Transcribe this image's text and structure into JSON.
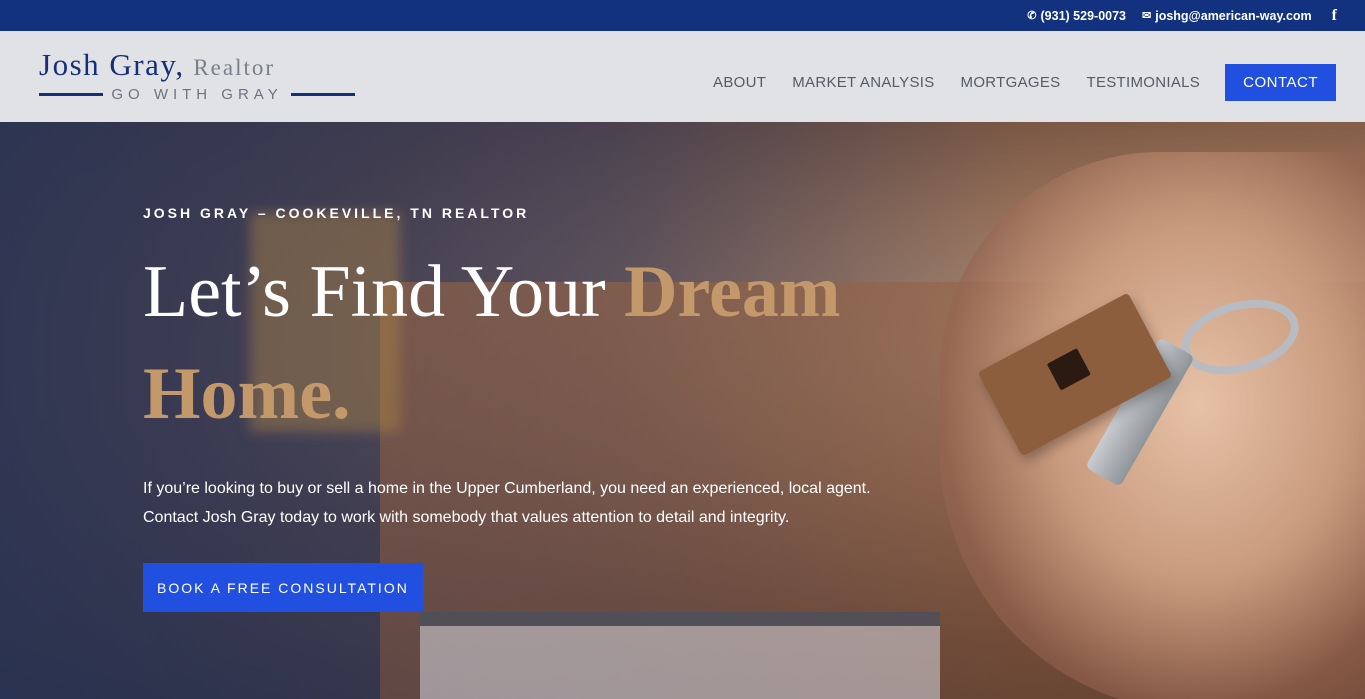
{
  "topbar": {
    "phone": "(931) 529-0073",
    "email": "joshg@american-way.com",
    "phone_icon": "phone-icon",
    "email_icon": "envelope-icon",
    "social_icon": "facebook-icon",
    "social_glyph": "f",
    "background": "#12317f"
  },
  "header": {
    "logo": {
      "name_first": "Josh Gray,",
      "name_second": "Realtor",
      "tagline": "GO WITH GRAY"
    },
    "nav": [
      {
        "label": "ABOUT"
      },
      {
        "label": "MARKET ANALYSIS"
      },
      {
        "label": "MORTGAGES"
      },
      {
        "label": "TESTIMONIALS"
      }
    ],
    "contact_label": "CONTACT"
  },
  "hero": {
    "kicker": "JOSH GRAY – COOKEVILLE, TN REALTOR",
    "headline_plain": "Let’s Find Your ",
    "headline_accent": "Dream Home.",
    "description": "If you’re looking to buy or sell a home in the Upper Cumberland, you need an experienced, local agent.  Contact Josh Gray today to work with somebody that values attention to detail and integrity.",
    "cta_label": "BOOK A FREE CONSULTATION"
  },
  "colors": {
    "accent_blue": "#2150e0",
    "brand_navy": "#14307a",
    "headline_gold": "#c3996b"
  }
}
